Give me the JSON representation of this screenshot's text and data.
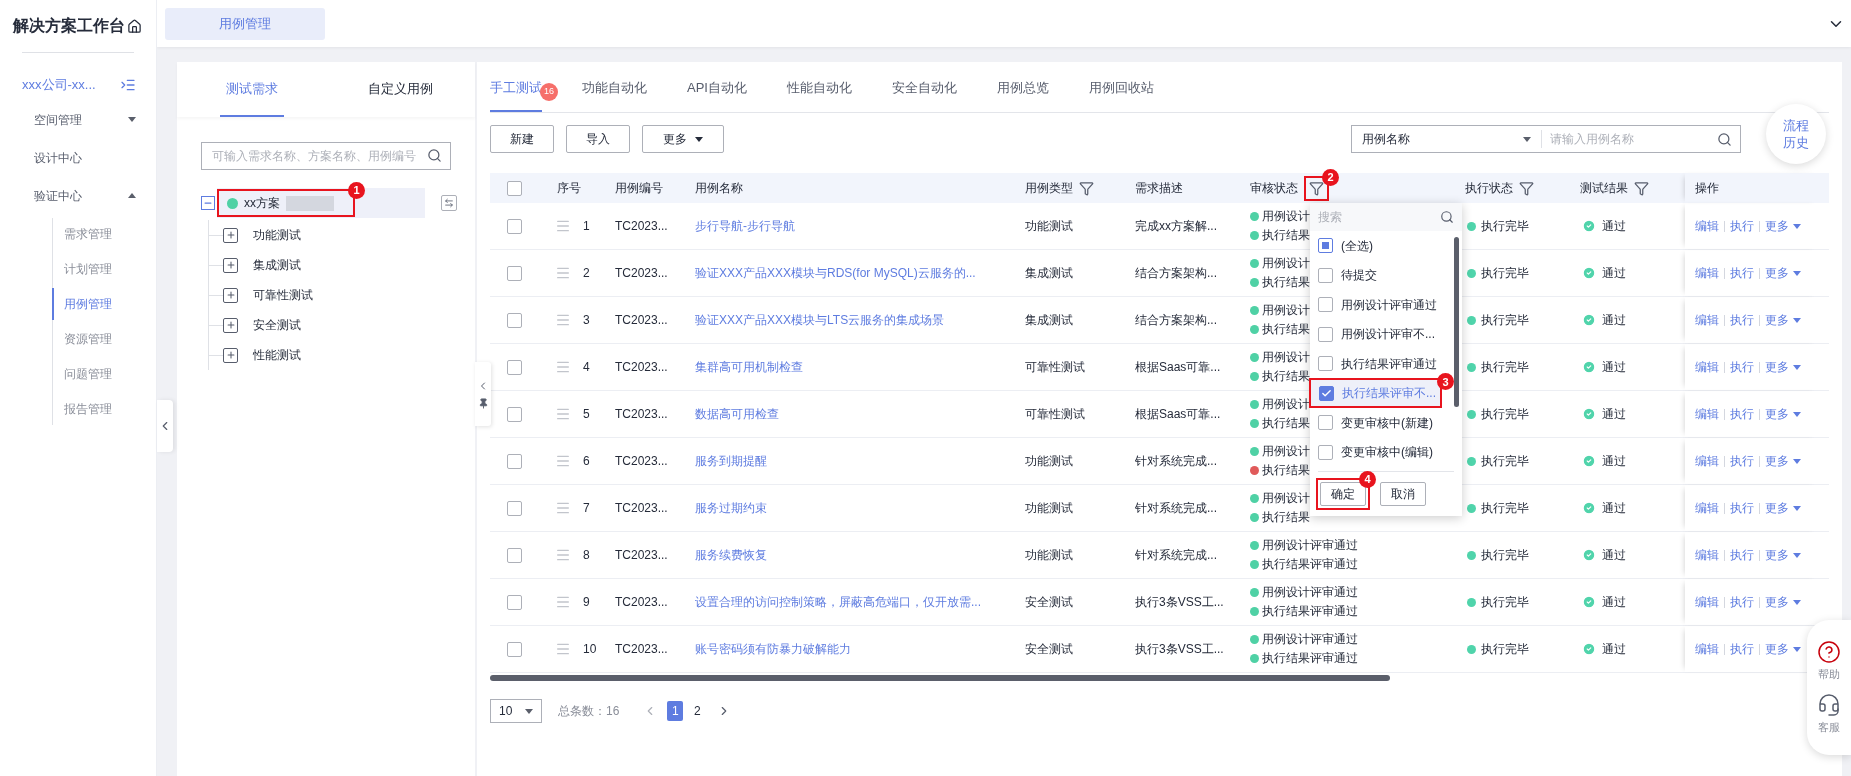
{
  "sidebar": {
    "title": "解决方案工作台",
    "org": "xxx公司-xx...",
    "menu": [
      {
        "label": "空间管理",
        "kind": "group",
        "expanded": false
      },
      {
        "label": "设计中心",
        "kind": "link"
      },
      {
        "label": "验证中心",
        "kind": "group",
        "expanded": true,
        "children": [
          {
            "label": "需求管理",
            "selected": false
          },
          {
            "label": "计划管理",
            "selected": false
          },
          {
            "label": "用例管理",
            "selected": true
          },
          {
            "label": "资源管理",
            "selected": false
          },
          {
            "label": "问题管理",
            "selected": false
          },
          {
            "label": "报告管理",
            "selected": false
          }
        ]
      }
    ]
  },
  "top_tabs": [
    {
      "label": "用例管理",
      "selected": true
    }
  ],
  "left_panel": {
    "tabs": [
      {
        "label": "测试需求",
        "selected": true
      },
      {
        "label": "自定义用例",
        "selected": false
      }
    ],
    "search": {
      "placeholder": "可输入需求名称、方案名称、用例编号"
    },
    "tree": {
      "label": "xx方案",
      "color": "#4fd1a5",
      "expanded": true,
      "redacted": true,
      "callout": "1",
      "children": [
        {
          "label": "功能测试",
          "expanded": false
        },
        {
          "label": "集成测试",
          "expanded": false
        },
        {
          "label": "可靠性测试",
          "expanded": false
        },
        {
          "label": "安全测试",
          "expanded": false
        },
        {
          "label": "性能测试",
          "expanded": false
        }
      ]
    }
  },
  "main_tabs": [
    {
      "label": "手工测试",
      "selected": true,
      "badge": "16"
    },
    {
      "label": "功能自动化",
      "selected": false
    },
    {
      "label": "API自动化",
      "selected": false
    },
    {
      "label": "性能自动化",
      "selected": false
    },
    {
      "label": "安全自动化",
      "selected": false
    },
    {
      "label": "用例总览",
      "selected": false
    },
    {
      "label": "用例回收站",
      "selected": false
    }
  ],
  "toolbar": {
    "buttons": [
      {
        "label": "新建",
        "kind": "plain"
      },
      {
        "label": "导入",
        "kind": "plain"
      },
      {
        "label": "更多",
        "kind": "menu"
      }
    ],
    "search_field": {
      "selector": "用例名称",
      "placeholder": "请输入用例名称"
    }
  },
  "history_button": "流程历史",
  "table": {
    "columns": [
      {
        "kind": "checkbox",
        "checked": false
      },
      {
        "kind": "text",
        "label": "序号",
        "filter": false
      },
      {
        "kind": "text",
        "label": "用例编号",
        "filter": false
      },
      {
        "kind": "text",
        "label": "用例名称",
        "filter": false
      },
      {
        "kind": "text",
        "label": "用例类型",
        "filter": true
      },
      {
        "kind": "text",
        "label": "需求描述",
        "filter": false
      },
      {
        "kind": "text",
        "label": "审核状态",
        "filter": true,
        "callout": "2"
      },
      {
        "kind": "text",
        "label": "执行状态",
        "filter": true
      },
      {
        "kind": "text",
        "label": "测试结果",
        "filter": true
      },
      {
        "kind": "text",
        "label": "操作",
        "filter": false
      }
    ],
    "rows": [
      {
        "checked": false,
        "index": "1",
        "id": "TC2023...",
        "name": "步行导航-步行导航",
        "type": "功能测试",
        "description": "完成xx方案解...",
        "review": [
          {
            "text": "用例设计",
            "color": "#4fd1a5"
          },
          {
            "text": "执行结果",
            "color": "#4fd1a5"
          }
        ],
        "exec": "执行完毕",
        "result": "通过",
        "actions": [
          {
            "label": "编辑",
            "kind": "link"
          },
          {
            "label": "执行",
            "kind": "link"
          },
          {
            "label": "更多",
            "kind": "menu"
          }
        ]
      },
      {
        "checked": false,
        "index": "2",
        "id": "TC2023...",
        "name": "验证XXX产品XXX模块与RDS(for MySQL)云服务的...",
        "type": "集成测试",
        "description": "结合方案架构...",
        "review": [
          {
            "text": "用例设计",
            "color": "#4fd1a5"
          },
          {
            "text": "执行结果",
            "color": "#4fd1a5"
          }
        ],
        "exec": "执行完毕",
        "result": "通过",
        "actions": [
          {
            "label": "编辑",
            "kind": "link"
          },
          {
            "label": "执行",
            "kind": "link"
          },
          {
            "label": "更多",
            "kind": "menu"
          }
        ]
      },
      {
        "checked": false,
        "index": "3",
        "id": "TC2023...",
        "name": "验证XXX产品XXX模块与LTS云服务的集成场景",
        "type": "集成测试",
        "description": "结合方案架构...",
        "review": [
          {
            "text": "用例设计",
            "color": "#4fd1a5"
          },
          {
            "text": "执行结果",
            "color": "#4fd1a5"
          }
        ],
        "exec": "执行完毕",
        "result": "通过",
        "actions": [
          {
            "label": "编辑",
            "kind": "link"
          },
          {
            "label": "执行",
            "kind": "link"
          },
          {
            "label": "更多",
            "kind": "menu"
          }
        ]
      },
      {
        "checked": false,
        "index": "4",
        "id": "TC2023...",
        "name": "集群高可用机制检查",
        "type": "可靠性测试",
        "description": "根据Saas可靠...",
        "review": [
          {
            "text": "用例设计",
            "color": "#4fd1a5"
          },
          {
            "text": "执行结果",
            "color": "#4fd1a5"
          }
        ],
        "exec": "执行完毕",
        "result": "通过",
        "actions": [
          {
            "label": "编辑",
            "kind": "link"
          },
          {
            "label": "执行",
            "kind": "link"
          },
          {
            "label": "更多",
            "kind": "menu"
          }
        ]
      },
      {
        "checked": false,
        "index": "5",
        "id": "TC2023...",
        "name": "数据高可用检查",
        "type": "可靠性测试",
        "description": "根据Saas可靠...",
        "review": [
          {
            "text": "用例设计",
            "color": "#4fd1a5"
          },
          {
            "text": "执行结果",
            "color": "#4fd1a5"
          }
        ],
        "exec": "执行完毕",
        "result": "通过",
        "actions": [
          {
            "label": "编辑",
            "kind": "link"
          },
          {
            "label": "执行",
            "kind": "link"
          },
          {
            "label": "更多",
            "kind": "menu"
          }
        ]
      },
      {
        "checked": false,
        "index": "6",
        "id": "TC2023...",
        "name": "服务到期提醒",
        "type": "功能测试",
        "description": "针对系统完成...",
        "review": [
          {
            "text": "用例设计",
            "color": "#4fd1a5"
          },
          {
            "text": "执行结果",
            "color": "#e05a5a"
          }
        ],
        "exec": "执行完毕",
        "result": "通过",
        "actions": [
          {
            "label": "编辑",
            "kind": "link"
          },
          {
            "label": "执行",
            "kind": "link"
          },
          {
            "label": "更多",
            "kind": "menu"
          }
        ]
      },
      {
        "checked": false,
        "index": "7",
        "id": "TC2023...",
        "name": "服务过期约束",
        "type": "功能测试",
        "description": "针对系统完成...",
        "review": [
          {
            "text": "用例设计",
            "color": "#4fd1a5"
          },
          {
            "text": "执行结果",
            "color": "#4fd1a5"
          }
        ],
        "exec": "执行完毕",
        "result": "通过",
        "actions": [
          {
            "label": "编辑",
            "kind": "link"
          },
          {
            "label": "执行",
            "kind": "link"
          },
          {
            "label": "更多",
            "kind": "menu"
          }
        ]
      },
      {
        "checked": false,
        "index": "8",
        "id": "TC2023...",
        "name": "服务续费恢复",
        "type": "功能测试",
        "description": "针对系统完成...",
        "review": [
          {
            "text": "用例设计评审通过",
            "color": "#4fd1a5"
          },
          {
            "text": "执行结果评审通过",
            "color": "#4fd1a5"
          }
        ],
        "exec": "执行完毕",
        "result": "通过",
        "actions": [
          {
            "label": "编辑",
            "kind": "link"
          },
          {
            "label": "执行",
            "kind": "link"
          },
          {
            "label": "更多",
            "kind": "menu"
          }
        ]
      },
      {
        "checked": false,
        "index": "9",
        "id": "TC2023...",
        "name": "设置合理的访问控制策略，屏蔽高危端口，仅开放需...",
        "type": "安全测试",
        "description": "执行3条VSS工...",
        "review": [
          {
            "text": "用例设计评审通过",
            "color": "#4fd1a5"
          },
          {
            "text": "执行结果评审通过",
            "color": "#4fd1a5"
          }
        ],
        "exec": "执行完毕",
        "result": "通过",
        "actions": [
          {
            "label": "编辑",
            "kind": "link"
          },
          {
            "label": "执行",
            "kind": "link"
          },
          {
            "label": "更多",
            "kind": "menu"
          }
        ]
      },
      {
        "checked": false,
        "index": "10",
        "id": "TC2023...",
        "name": "账号密码须有防暴力破解能力",
        "type": "安全测试",
        "description": "执行3条VSS工...",
        "review": [
          {
            "text": "用例设计评审通过",
            "color": "#4fd1a5"
          },
          {
            "text": "执行结果评审通过",
            "color": "#4fd1a5"
          }
        ],
        "exec": "执行完毕",
        "result": "通过",
        "actions": [
          {
            "label": "编辑",
            "kind": "link"
          },
          {
            "label": "执行",
            "kind": "link"
          },
          {
            "label": "更多",
            "kind": "menu"
          }
        ]
      }
    ]
  },
  "filter_popup": {
    "search_placeholder": "搜索",
    "options": [
      {
        "label": "(全选)",
        "checked": false,
        "partial": true,
        "selected": false
      },
      {
        "label": "待提交",
        "checked": false,
        "partial": false,
        "selected": false
      },
      {
        "label": "用例设计评审通过",
        "checked": false,
        "partial": false,
        "selected": false
      },
      {
        "label": "用例设计评审不...",
        "checked": false,
        "partial": false,
        "selected": false
      },
      {
        "label": "执行结果评审通过",
        "checked": false,
        "partial": false,
        "selected": false
      },
      {
        "label": "执行结果评审不...",
        "checked": true,
        "partial": false,
        "selected": true,
        "callout": "3"
      },
      {
        "label": "变更审核中(新建)",
        "checked": false,
        "partial": false,
        "selected": false
      },
      {
        "label": "变更审核中(编辑)",
        "checked": false,
        "partial": false,
        "selected": false
      }
    ],
    "buttons": [
      {
        "label": "确定",
        "callout": "4"
      },
      {
        "label": "取消"
      }
    ]
  },
  "pagination": {
    "page_size": "10",
    "total": "总条数：16",
    "pages": [
      {
        "label": "1",
        "selected": true
      },
      {
        "label": "2",
        "selected": false
      }
    ]
  },
  "help_widget": [
    {
      "label": "帮助",
      "kind": "help"
    },
    {
      "label": "客服",
      "kind": "service"
    }
  ]
}
